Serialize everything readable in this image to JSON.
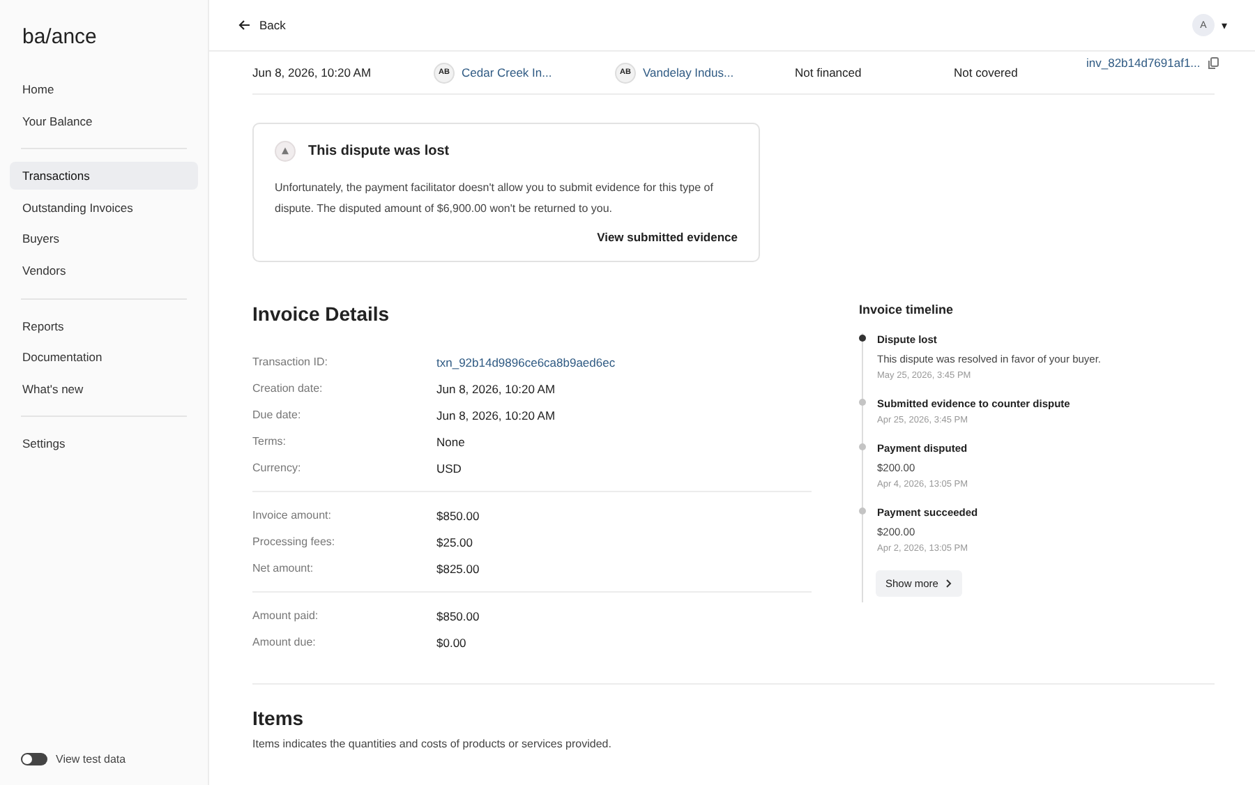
{
  "sidebar": {
    "logo": "ba/ance",
    "groups": [
      [
        {
          "label": "Home",
          "selected": false
        },
        {
          "label": "Your Balance",
          "selected": false
        }
      ],
      [
        {
          "label": "Transactions",
          "selected": true
        },
        {
          "label": "Outstanding Invoices",
          "selected": false
        },
        {
          "label": "Buyers",
          "selected": false
        },
        {
          "label": "Vendors",
          "selected": false
        }
      ],
      [
        {
          "label": "Reports",
          "selected": false
        },
        {
          "label": "Documentation",
          "selected": false
        },
        {
          "label": "What's new",
          "selected": false
        }
      ],
      [
        {
          "label": "Settings",
          "selected": false
        }
      ]
    ],
    "test_data_toggle": {
      "label": "View test data",
      "on": false
    }
  },
  "header": {
    "back": "Back",
    "avatar": "A",
    "caret": "▾"
  },
  "transaction_row": {
    "date": "Jun 8, 2026, 10:20 AM",
    "buyer": {
      "initials": "AB",
      "name": "Cedar Creek In..."
    },
    "vendor": {
      "initials": "AB",
      "name": "Vandelay Indus..."
    },
    "financing": "Not financed",
    "coverage": "Not covered",
    "invoice_id": "inv_82b14d7691af1..."
  },
  "alert": {
    "title": "This dispute was lost",
    "message": "Unfortunately, the payment facilitator doesn't allow you to submit evidence for this type of dispute. The disputed amount of $6,900.00 won't be returned to you.",
    "action": "View submitted evidence"
  },
  "invoice_details": {
    "title": "Invoice Details",
    "groups": [
      [
        {
          "label": "Transaction ID:",
          "value": "txn_92b14d9896ce6ca8b9aed6ec",
          "kind": "link"
        },
        {
          "label": "Creation date:",
          "value": "Jun 8, 2026, 10:20 AM",
          "kind": "text"
        },
        {
          "label": "Due date:",
          "value": "Jun 8, 2026, 10:20 AM",
          "kind": "text"
        },
        {
          "label": "Terms:",
          "value": "None",
          "kind": "text"
        },
        {
          "label": "Currency:",
          "value": "USD",
          "kind": "text"
        }
      ],
      [
        {
          "label": "Invoice amount:",
          "value": "$850.00",
          "kind": "text"
        },
        {
          "label": "Processing fees:",
          "value": "$25.00",
          "kind": "text"
        },
        {
          "label": "Net amount:",
          "value": "$825.00",
          "kind": "text"
        }
      ],
      [
        {
          "label": "Amount paid:",
          "value": "$850.00",
          "kind": "text"
        },
        {
          "label": "Amount due:",
          "value": "$0.00",
          "kind": "text"
        }
      ]
    ]
  },
  "timeline": {
    "title": "Invoice timeline",
    "events": [
      {
        "title": "Dispute lost",
        "detail": "This dispute was resolved in favor of your buyer.",
        "date": "May 25, 2026, 3:45 PM",
        "current": true
      },
      {
        "title": "Submitted evidence to counter dispute",
        "date": "Apr 25, 2026, 3:45 PM",
        "current": false
      },
      {
        "title": "Payment disputed",
        "detail": "$200.00",
        "date": "Apr 4, 2026, 13:05 PM",
        "current": false
      },
      {
        "title": "Payment succeeded",
        "detail": "$200.00",
        "date": "Apr 2, 2026, 13:05 PM",
        "current": false
      }
    ],
    "show_more": "Show more"
  },
  "items": {
    "title": "Items",
    "description": "Items indicates the quantities and costs of products or services provided."
  }
}
